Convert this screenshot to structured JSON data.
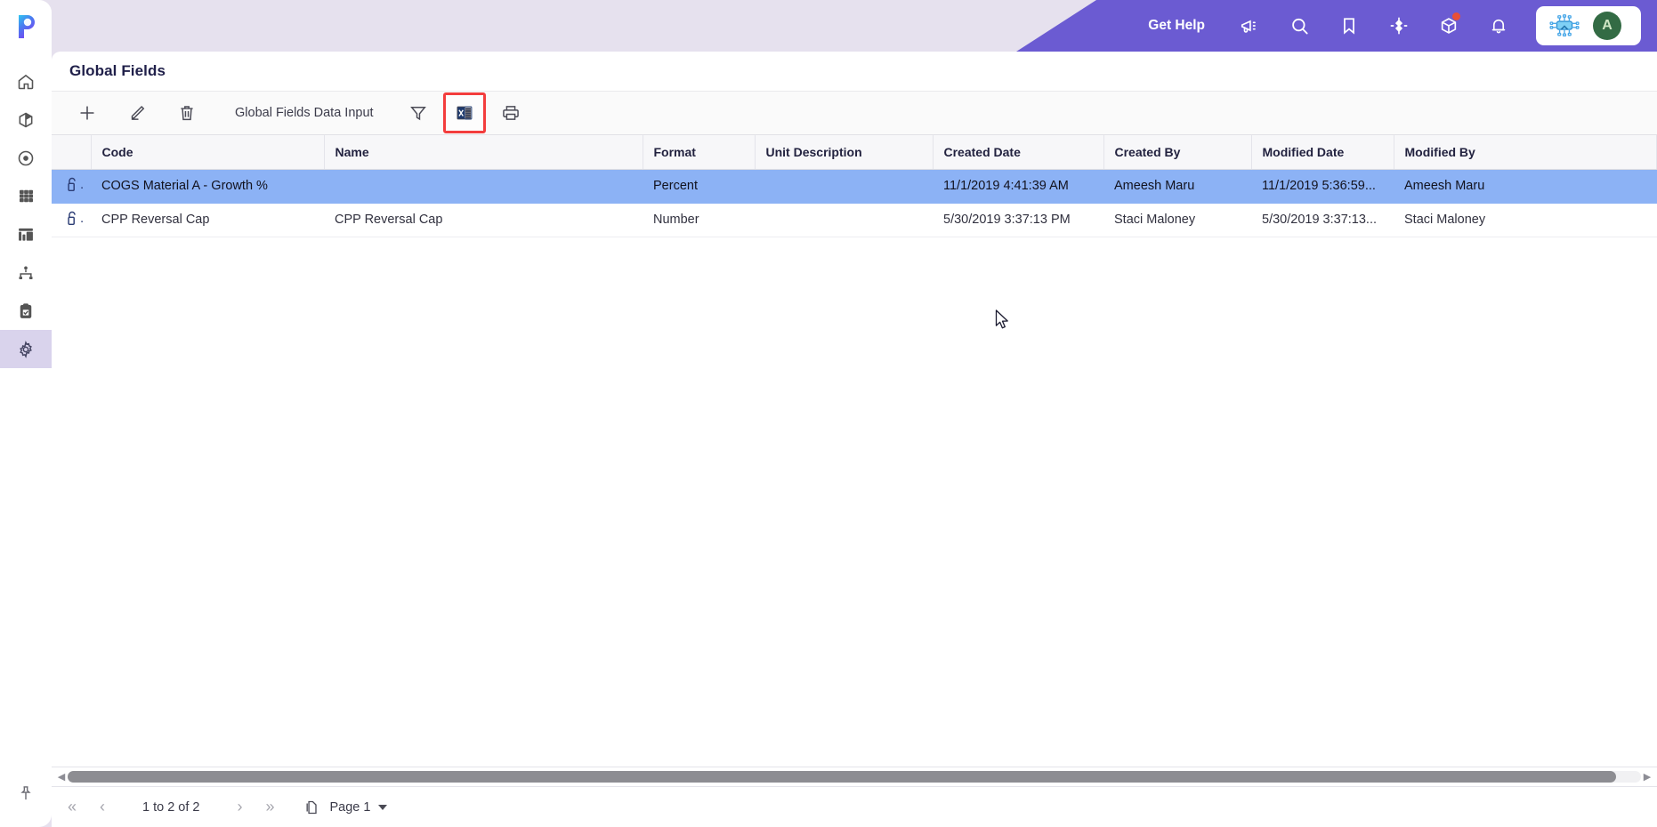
{
  "app": {
    "logo": "p-logo",
    "accent_purple": "#6b5bd2",
    "topbar_bg": "#e6e1ee",
    "selection_blue": "#8cb2f5",
    "highlight_red": "#f33d3d"
  },
  "sidebar": {
    "items": [
      {
        "name": "home",
        "icon": "home-icon",
        "active": false
      },
      {
        "name": "models",
        "icon": "cube-icon",
        "active": false
      },
      {
        "name": "target",
        "icon": "target-icon",
        "active": false
      },
      {
        "name": "grid",
        "icon": "grid-icon",
        "active": false
      },
      {
        "name": "reports",
        "icon": "bar-chart-icon",
        "active": false
      },
      {
        "name": "hierarchy",
        "icon": "hierarchy-icon",
        "active": false
      },
      {
        "name": "tasks",
        "icon": "clipboard-check-icon",
        "active": false
      },
      {
        "name": "settings",
        "icon": "gear-icon",
        "active": true
      }
    ],
    "pin": {
      "name": "pin",
      "icon": "pin-icon"
    }
  },
  "topbar": {
    "get_help_label": "Get Help",
    "icons": [
      {
        "name": "announcements",
        "icon": "megaphone-icon",
        "badge": false
      },
      {
        "name": "search",
        "icon": "search-icon",
        "badge": false
      },
      {
        "name": "bookmarks",
        "icon": "bookmark-icon",
        "badge": false
      },
      {
        "name": "navigate",
        "icon": "crosshair-icon",
        "badge": false
      },
      {
        "name": "packages",
        "icon": "box-icon",
        "badge": true
      },
      {
        "name": "notifications",
        "icon": "bell-icon",
        "badge": false
      }
    ],
    "assistant_icon": "ai-chip-icon",
    "avatar_initial": "A"
  },
  "page": {
    "title": "Global Fields"
  },
  "toolbar": {
    "add_label": "add",
    "edit_label": "edit",
    "delete_label": "delete",
    "data_input_label": "Global Fields Data Input",
    "filter_label": "filter",
    "excel_label": "export-to-excel",
    "print_label": "print"
  },
  "table": {
    "columns": [
      {
        "key": "lock",
        "label": ""
      },
      {
        "key": "code",
        "label": "Code"
      },
      {
        "key": "name",
        "label": "Name"
      },
      {
        "key": "format",
        "label": "Format"
      },
      {
        "key": "unit_description",
        "label": "Unit Description"
      },
      {
        "key": "created_date",
        "label": "Created Date"
      },
      {
        "key": "created_by",
        "label": "Created By"
      },
      {
        "key": "modified_date",
        "label": "Modified Date"
      },
      {
        "key": "modified_by",
        "label": "Modified By"
      }
    ],
    "rows": [
      {
        "selected": true,
        "lock": "lock-icon",
        "code": "COGS Material A - Growth %",
        "name": "",
        "format": "Percent",
        "unit_description": "",
        "created_date": "11/1/2019 4:41:39 AM",
        "created_by": "Ameesh Maru",
        "modified_date": "11/1/2019 5:36:59...",
        "modified_by": "Ameesh Maru"
      },
      {
        "selected": false,
        "lock": "lock-icon",
        "code": "CPP Reversal Cap",
        "name": "CPP Reversal Cap",
        "format": "Number",
        "unit_description": "",
        "created_date": "5/30/2019 3:37:13 PM",
        "created_by": "Staci Maloney",
        "modified_date": "5/30/2019 3:37:13...",
        "modified_by": "Staci Maloney"
      }
    ]
  },
  "pager": {
    "first_label": "«",
    "prev_label": "‹",
    "status": "1 to 2 of 2",
    "next_label": "›",
    "last_label": "»",
    "page_icon": "pages-icon",
    "page_label": "Page 1"
  }
}
